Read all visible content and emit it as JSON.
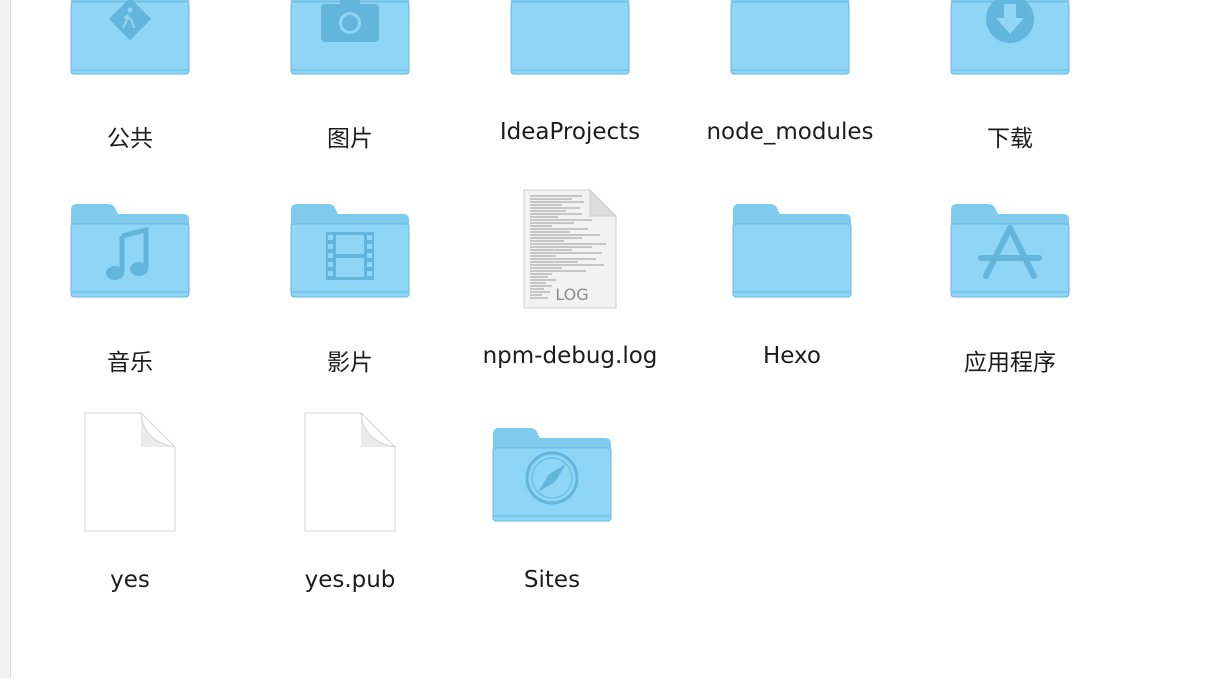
{
  "colors": {
    "folder_front": "#8fd6f6",
    "folder_back": "#7fcbee",
    "folder_edge": "#6ab9e0",
    "folder_glyph": "#63b5dc"
  },
  "items": [
    {
      "label": "公共",
      "kind": "folder",
      "icon": "public-folder-icon"
    },
    {
      "label": "图片",
      "kind": "folder",
      "icon": "pictures-folder-icon"
    },
    {
      "label": "IdeaProjects",
      "kind": "folder",
      "icon": "folder-icon"
    },
    {
      "label": "node_modules",
      "kind": "folder",
      "icon": "folder-icon"
    },
    {
      "label": "下载",
      "kind": "folder",
      "icon": "downloads-folder-icon"
    },
    {
      "label": "音乐",
      "kind": "folder",
      "icon": "music-folder-icon"
    },
    {
      "label": "影片",
      "kind": "folder",
      "icon": "movies-folder-icon"
    },
    {
      "label": "npm-debug.log",
      "kind": "file",
      "icon": "log-file-icon",
      "badge": "LOG"
    },
    {
      "label": "Hexo",
      "kind": "folder",
      "icon": "folder-icon"
    },
    {
      "label": "应用程序",
      "kind": "folder",
      "icon": "applications-folder-icon"
    },
    {
      "label": "yes",
      "kind": "file",
      "icon": "blank-file-icon"
    },
    {
      "label": "yes.pub",
      "kind": "file",
      "icon": "blank-file-icon"
    },
    {
      "label": "Sites",
      "kind": "folder",
      "icon": "sites-folder-icon"
    }
  ]
}
